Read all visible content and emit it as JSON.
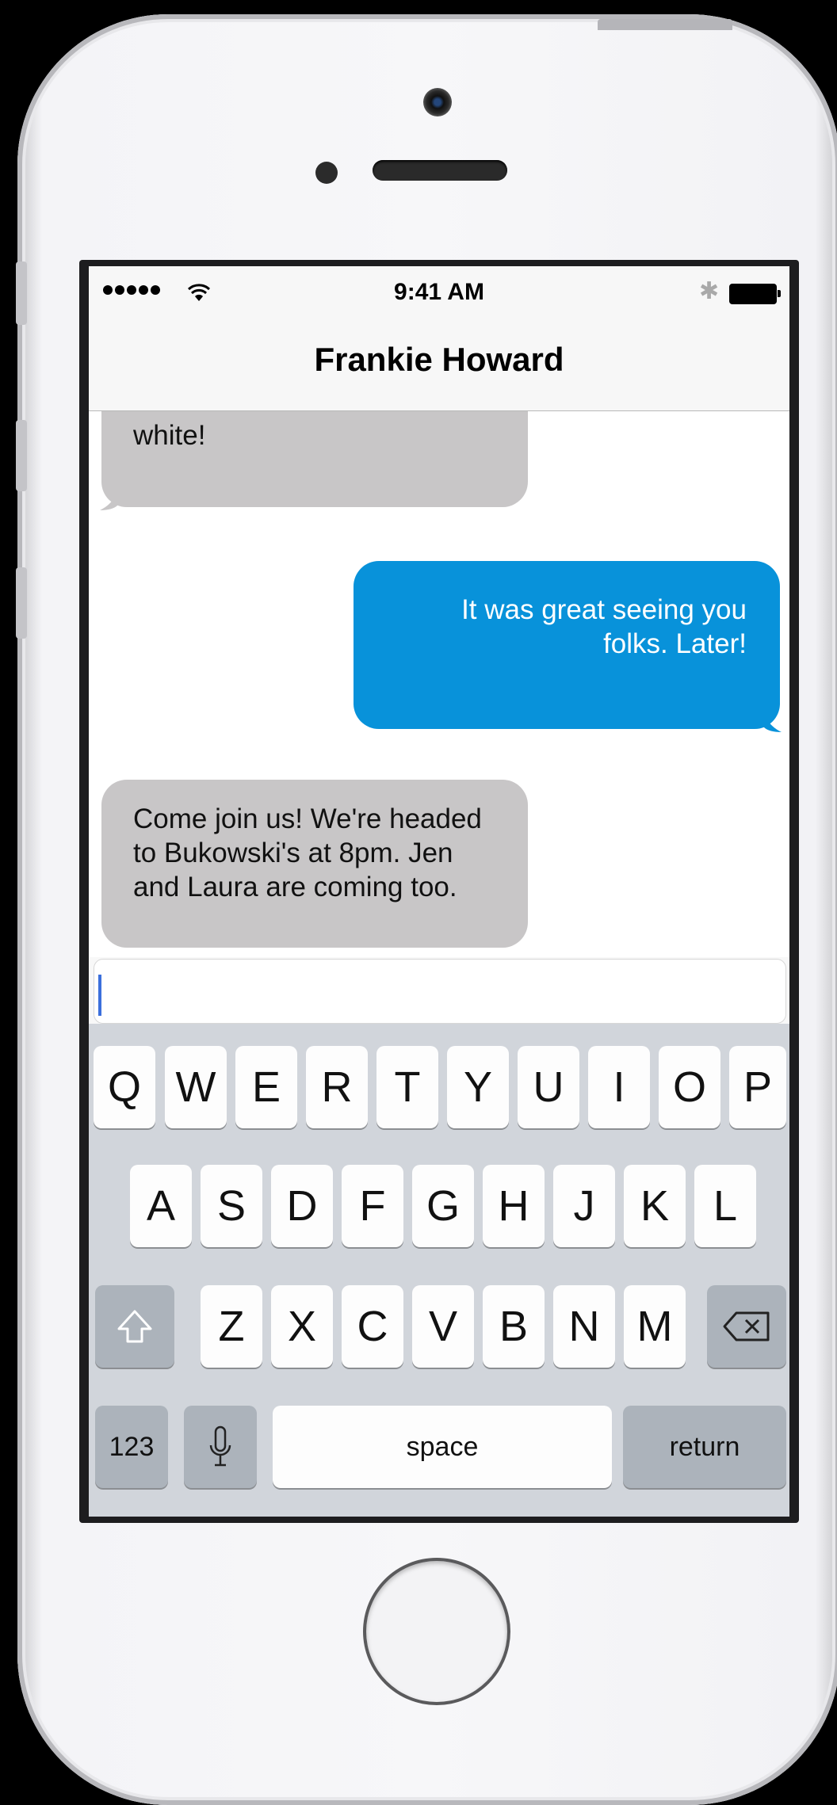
{
  "status_bar": {
    "time": "9:41 AM",
    "wifi_icon": "wifi-icon",
    "bluetooth_icon": "bluetooth-icon",
    "battery_icon": "battery-icon"
  },
  "conversation": {
    "contact_name": "Frankie Howard",
    "messages": [
      {
        "direction": "incoming",
        "text": "white!"
      },
      {
        "direction": "outgoing",
        "text": "It was great seeing you folks. Later!"
      },
      {
        "direction": "incoming",
        "text": "Come join us! We're headed to Bukowski's at 8pm. Jen and Laura are coming too."
      }
    ]
  },
  "compose": {
    "value": "",
    "placeholder": ""
  },
  "keyboard": {
    "row1": [
      "Q",
      "W",
      "E",
      "R",
      "T",
      "Y",
      "U",
      "I",
      "O",
      "P"
    ],
    "row2": [
      "A",
      "S",
      "D",
      "F",
      "G",
      "H",
      "J",
      "K",
      "L"
    ],
    "row3": [
      "Z",
      "X",
      "C",
      "V",
      "B",
      "N",
      "M"
    ],
    "numbers_label": "123",
    "space_label": "space",
    "return_label": "return",
    "shift_icon": "shift-icon",
    "delete_icon": "delete-icon",
    "mic_icon": "microphone-icon"
  },
  "colors": {
    "outgoing_bubble": "#0892da",
    "incoming_bubble": "#c8c6c7",
    "keyboard_bg": "#d1d5db"
  }
}
